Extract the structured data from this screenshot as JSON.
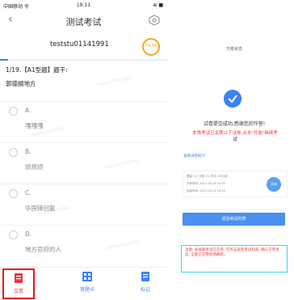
{
  "status_bar": {
    "carrier": "中国移动 令",
    "time": "19:11",
    "battery": "⊕ ■"
  },
  "nav": {
    "title": "测试考试"
  },
  "header": {
    "username": "teststu01141991",
    "timer": "59:54",
    "progress_fraction": 0.05
  },
  "question": {
    "title": "1/19.【A1型题】题干:",
    "text": "郭德纲地方"
  },
  "watermark": "teststu01141991",
  "options": [
    {
      "letter": "A.",
      "text": "嘎嘎嘎"
    },
    {
      "letter": "B.",
      "text": "烦烦烦"
    },
    {
      "letter": "C.",
      "text": "华国锋回复"
    },
    {
      "letter": "D.",
      "text": "地方官府的人"
    }
  ],
  "tabs": {
    "submit": "交卷",
    "answer_sheet": "答题卡",
    "mark": "标记"
  },
  "right": {
    "title": "交卷状态",
    "message": "试卷提交成功,感谢您的作答!",
    "sub_part1": "本场考试已关联以下试卷,点击\"开始\"继续考",
    "sub_part2": "试",
    "link": "查看试卷统计",
    "card_lines": [
      "题量: 21  分值: 21  时长: 60分钟",
      "开考时间: 2021-04-14 14:30",
      "结束时间: 2021-04-14 15:30"
    ],
    "card_button": "开始",
    "back_button": "返回考试列表",
    "note": "注意: 如关联考试已交卷, 可点击返回考试列表, 确认交卷状态, 全部已交卷后请刷新。"
  },
  "colors": {
    "accent": "#3b82f6",
    "timer": "#f5a623",
    "danger": "#e11111",
    "note_border": "#38d8ee"
  }
}
